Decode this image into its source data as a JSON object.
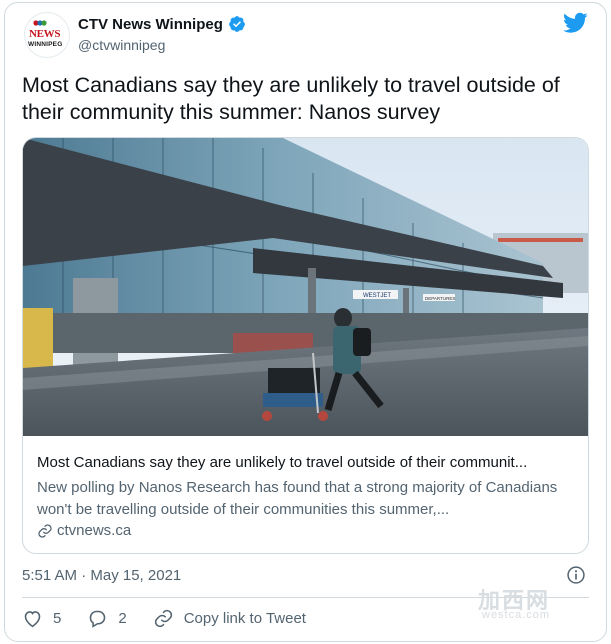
{
  "author": {
    "display_name": "CTV News Winnipeg",
    "handle": "@ctvwinnipeg",
    "verified": true,
    "logo_text": "NEWS",
    "logo_subtext": "WINNIPEG"
  },
  "tweet": {
    "text": "Most Canadians say they are unlikely to travel outside of their community this summer: Nanos survey",
    "timestamp": "5:51 AM · May 15, 2021"
  },
  "link_card": {
    "title": "Most Canadians say they are unlikely to travel outside of their communit...",
    "description": "New polling by Nanos Research has found that a strong majority of Canadians won't be travelling outside of their communities this summer,...",
    "domain": "ctvnews.ca",
    "photo_signs": [
      "WESTJET",
      "DEPARTURES"
    ]
  },
  "actions": {
    "likes": "5",
    "replies": "2",
    "copy_link": "Copy link to Tweet"
  },
  "watermark": {
    "main": "加西网",
    "sub": "westca.com"
  },
  "colors": {
    "twitter_blue": "#1d9bf0",
    "text_primary": "#0f1419",
    "text_secondary": "#536471",
    "border": "#cfd9de",
    "ctv_red": "#c4161c"
  }
}
